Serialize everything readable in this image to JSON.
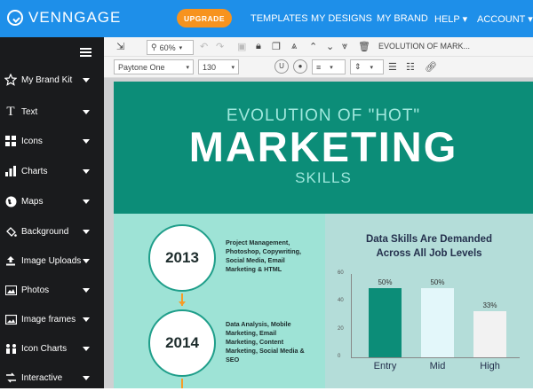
{
  "app": {
    "logo_text": "VENNGAGE",
    "upgrade_label": "UPGRADE"
  },
  "nav": [
    "TEMPLATES",
    "MY DESIGNS",
    "MY BRAND",
    "HELP ▾",
    "ACCOUNT ▾"
  ],
  "sidebar": [
    {
      "label": "My Brand Kit",
      "icon": "star-icon"
    },
    {
      "label": "Text",
      "icon": "text-icon"
    },
    {
      "label": "Icons",
      "icon": "grid-icon"
    },
    {
      "label": "Charts",
      "icon": "bar-chart-icon"
    },
    {
      "label": "Maps",
      "icon": "globe-icon"
    },
    {
      "label": "Background",
      "icon": "paint-bucket-icon"
    },
    {
      "label": "Image Uploads",
      "icon": "upload-icon"
    },
    {
      "label": "Photos",
      "icon": "photo-icon"
    },
    {
      "label": "Image frames",
      "icon": "frame-icon"
    },
    {
      "label": "Icon Charts",
      "icon": "icon-chart-icon"
    },
    {
      "label": "Interactive",
      "icon": "interactive-icon"
    }
  ],
  "toolbar": {
    "zoom": "60%",
    "doc_title": "EVOLUTION OF MARK...",
    "font": "Paytone One",
    "size": "130"
  },
  "infographic": {
    "title_top": "EVOLUTION OF \"HOT\"",
    "title_main": "MARKETING",
    "title_sub": "SKILLS",
    "timeline": [
      {
        "year": "2013",
        "lines": [
          "Project Management,",
          "Photoshop, Copywriting,",
          "Social Media, Email",
          "Marketing & HTML"
        ]
      },
      {
        "year": "2014",
        "lines": [
          "Data Analysis, Mobile",
          "Marketing, Email",
          "Marketing, Content",
          "Marketing, Social Media &",
          "SEO"
        ]
      }
    ],
    "chart_title_1": "Data Skills Are Demanded",
    "chart_title_2": "Across All Job Levels"
  },
  "chart_data": {
    "type": "bar",
    "categories": [
      "Entry",
      "Mid",
      "High"
    ],
    "values": [
      50,
      50,
      33
    ],
    "data_labels": [
      "50%",
      "50%",
      "33%"
    ],
    "ylim": [
      0,
      60
    ],
    "yticks": [
      "0",
      "20",
      "40",
      "60"
    ],
    "colors": [
      "#0c8d78",
      "#e3f7fa",
      "#f2f2f2"
    ]
  }
}
